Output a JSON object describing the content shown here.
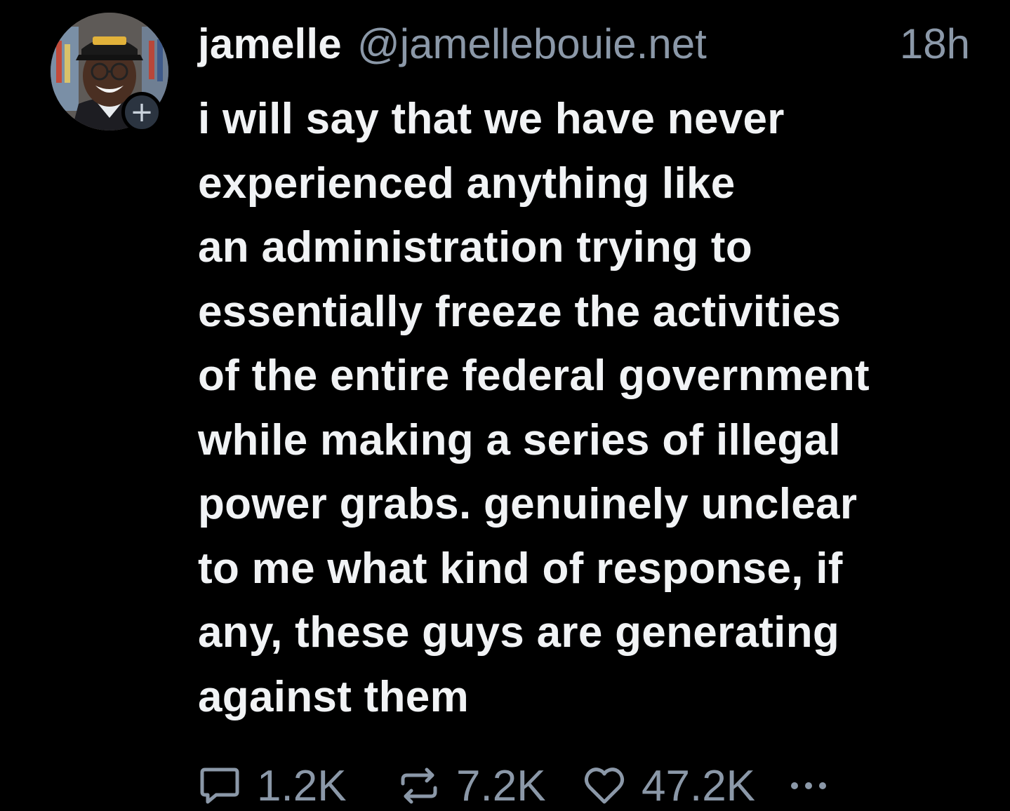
{
  "author": {
    "display_name": "jamelle",
    "handle": "@jamellebouie.net",
    "timestamp": "18h",
    "avatar_icon": "user-avatar",
    "follow_icon": "plus-icon",
    "follow_symbol": "+"
  },
  "post": {
    "lines": [
      "i will say that we have never",
      "experienced anything like",
      "an administration trying to",
      "essentially freeze the activities",
      "of the entire federal government",
      "while making a series of illegal",
      "power grabs. genuinely unclear",
      "to me what kind of response, if",
      "any, these guys are generating",
      "against them"
    ]
  },
  "actions": {
    "reply": {
      "icon": "reply-icon",
      "count": "1.2K"
    },
    "repost": {
      "icon": "repost-icon",
      "count": "7.2K"
    },
    "like": {
      "icon": "heart-icon",
      "count": "47.2K"
    },
    "more": {
      "icon": "more-options-icon"
    }
  },
  "colors": {
    "background": "#000000",
    "primary_text": "#f1f3f5",
    "secondary_text": "#8b98a8",
    "badge_bg": "#2b3440"
  }
}
